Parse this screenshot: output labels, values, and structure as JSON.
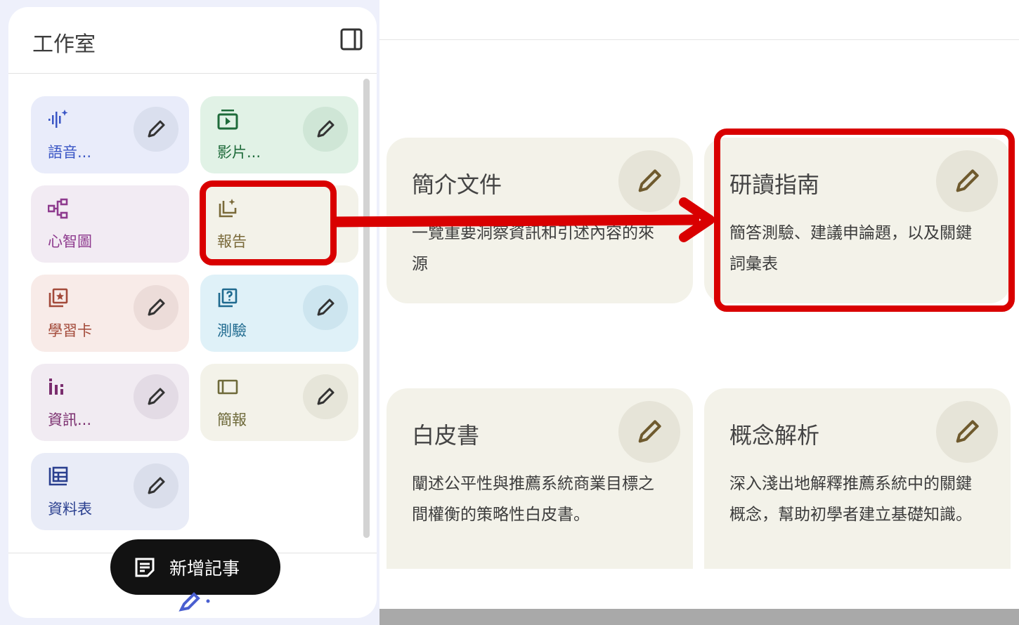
{
  "studio": {
    "title": "工作室",
    "tiles": [
      {
        "label": "語音...",
        "icon": "audio-waveform-icon",
        "color": "#3a56c5"
      },
      {
        "label": "影片...",
        "icon": "video-overview-icon",
        "color": "#1e6b3a"
      },
      {
        "label": "心智圖",
        "icon": "mind-map-icon",
        "color": "#8e3a8e"
      },
      {
        "label": "報告",
        "icon": "report-sparkle-icon",
        "color": "#7a6a3a"
      },
      {
        "label": "學習卡",
        "icon": "flashcards-icon",
        "color": "#a34a3a"
      },
      {
        "label": "測驗",
        "icon": "quiz-icon",
        "color": "#1f6a8f"
      },
      {
        "label": "資訊...",
        "icon": "infographic-icon",
        "color": "#7a2d6e"
      },
      {
        "label": "簡報",
        "icon": "slides-icon",
        "color": "#6e6a3a"
      },
      {
        "label": "資料表",
        "icon": "data-table-icon",
        "color": "#2a3f8f"
      }
    ],
    "add_note_label": "新增記事"
  },
  "reports": [
    {
      "title": "簡介文件",
      "description": "一覽重要洞察資訊和引述內容的來源"
    },
    {
      "title": "研讀指南",
      "description": "簡答測驗、建議申論題，以及關鍵詞彙表"
    },
    {
      "title": "白皮書",
      "description": "闡述公平性與推薦系統商業目標之間權衡的策略性白皮書。"
    },
    {
      "title": "概念解析",
      "description": "深入淺出地解釋推薦系統中的關鍵概念，幫助初學者建立基礎知識。"
    }
  ],
  "colors": {
    "highlight": "#d90000",
    "card_bg": "#f3f2e9",
    "edit_pencil": "#6f5a2e"
  }
}
